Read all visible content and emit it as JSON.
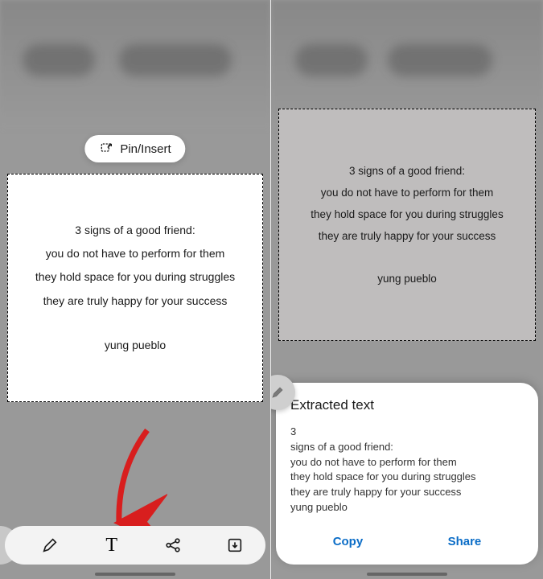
{
  "left": {
    "pin_insert_label": "Pin/Insert",
    "quote": {
      "line1": "3 signs of a good friend:",
      "line2": "you do not have to perform for them",
      "line3": "they hold space for you during struggles",
      "line4": "they are truly happy for your success",
      "signature": "yung pueblo"
    },
    "toolbar": {
      "draw": "pencil-icon",
      "text": "text-icon",
      "share": "share-icon",
      "save": "download-icon"
    }
  },
  "right": {
    "quote": {
      "line1": "3 signs of a good friend:",
      "line2": "you do not have to perform for them",
      "line3": "they hold space for you during struggles",
      "line4": "they are truly happy for your success",
      "signature": "yung pueblo"
    },
    "sheet": {
      "title": "Extracted text",
      "text_line1": "3",
      "text_line2": "signs of a good friend:",
      "text_line3": "you do not have to perform for them",
      "text_line4": "they hold space for you during struggles",
      "text_line5": "they are truly happy for your success",
      "text_line6": "yung pueblo",
      "copy_label": "Copy",
      "share_label": "Share"
    }
  }
}
